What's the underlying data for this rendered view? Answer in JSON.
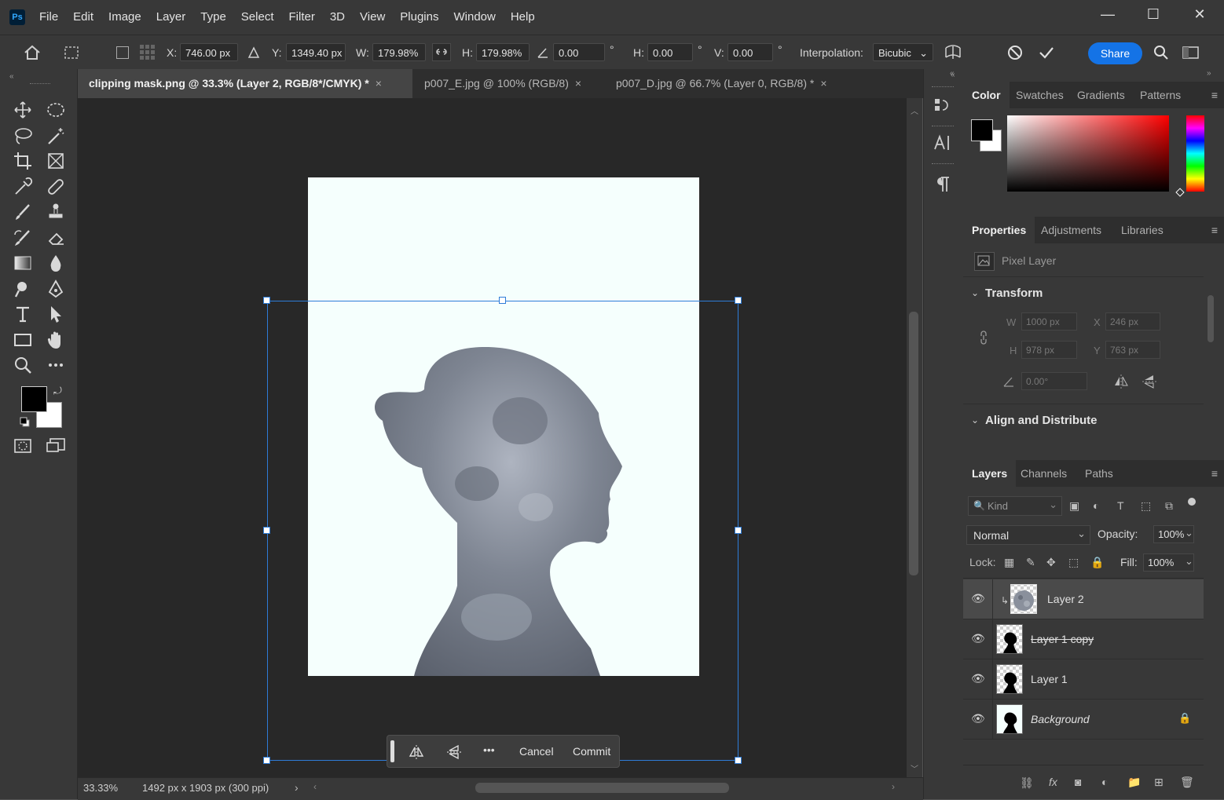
{
  "menubar": {
    "logo": "Ps",
    "items": [
      "File",
      "Edit",
      "Image",
      "Layer",
      "Type",
      "Select",
      "Filter",
      "3D",
      "View",
      "Plugins",
      "Window",
      "Help"
    ],
    "minimize": "—",
    "maximize": "☐",
    "close": "✕"
  },
  "options": {
    "x_label": "X:",
    "x_value": "746.00 px",
    "y_label": "Y:",
    "y_value": "1349.40 px",
    "w_label": "W:",
    "w_value": "179.98%",
    "h_label": "H:",
    "h_value": "179.98%",
    "angle_value": "0.00",
    "deg": "°",
    "hskew_label": "H:",
    "hskew_value": "0.00",
    "vskew_label": "V:",
    "vskew_value": "0.00",
    "interp_label": "Interpolation:",
    "interp_value": "Bicubic",
    "share_label": "Share"
  },
  "tabs": [
    {
      "label": "clipping mask.png @ 33.3% (Layer 2, RGB/8*/CMYK) *",
      "active": true
    },
    {
      "label": "p007_E.jpg @ 100% (RGB/8)",
      "active": false
    },
    {
      "label": "p007_D.jpg @ 66.7% (Layer 0, RGB/8) *",
      "active": false
    }
  ],
  "tab_close": "×",
  "status": {
    "zoom": "33.33%",
    "doc_info": "1492 px x 1903 px (300 ppi)",
    "arrow": "›"
  },
  "taskbar": {
    "more": "•••",
    "cancel": "Cancel",
    "commit": "Commit"
  },
  "color_panel": {
    "tabs": [
      "Color",
      "Swatches",
      "Gradients",
      "Patterns"
    ],
    "fg": "#000000",
    "bg": "#ffffff"
  },
  "properties_panel": {
    "tabs": [
      "Properties",
      "Adjustments",
      "Libraries"
    ],
    "kind": "Pixel Layer",
    "transform_title": "Transform",
    "w_label": "W",
    "w_value": "1000 px",
    "x_label": "X",
    "x_value": "246 px",
    "h_label": "H",
    "h_value": "978 px",
    "y_label": "Y",
    "y_value": "763 px",
    "angle_value": "0.00°",
    "align_title": "Align and Distribute"
  },
  "layers_panel": {
    "tabs": [
      "Layers",
      "Channels",
      "Paths"
    ],
    "kind_placeholder": "Kind",
    "blend_mode": "Normal",
    "opacity_label": "Opacity:",
    "opacity_value": "100%",
    "lock_label": "Lock:",
    "fill_label": "Fill:",
    "fill_value": "100%",
    "layers": [
      {
        "name": "Layer 2",
        "selected": true
      },
      {
        "name": "Layer 1 copy",
        "selected": false
      },
      {
        "name": "Layer 1",
        "selected": false
      },
      {
        "name": "Background",
        "selected": false
      }
    ],
    "footer_fx": "fx"
  },
  "colors": {
    "accent": "#1473e6",
    "transform_box": "#2e7cd8",
    "document_bg": "#f5fffd"
  }
}
